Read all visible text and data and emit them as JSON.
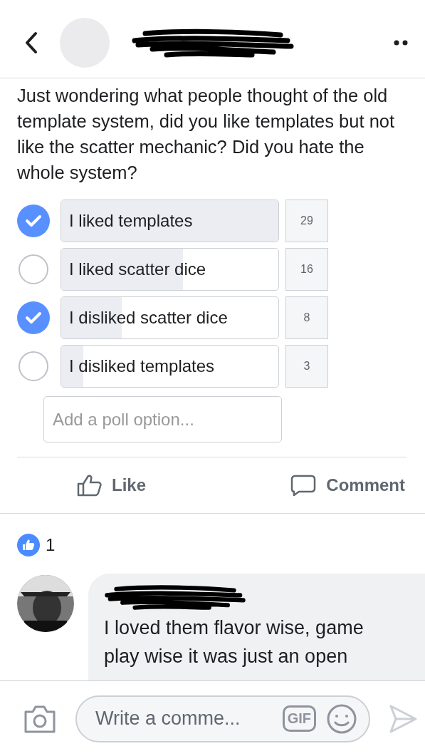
{
  "post": {
    "text": "Just wondering what people thought of the old template system, did you like templates but not like the scatter mechanic? Did you hate the whole system?"
  },
  "poll": {
    "options": [
      {
        "label": "I liked templates",
        "count": "29",
        "checked": true,
        "level": 1
      },
      {
        "label": "I liked scatter dice",
        "count": "16",
        "checked": false,
        "level": 0.56
      },
      {
        "label": "I disliked scatter dice",
        "count": "8",
        "checked": true,
        "level": 0.28
      },
      {
        "label": "I disliked templates",
        "count": "3",
        "checked": false,
        "level": 0.1
      }
    ],
    "add_placeholder": "Add a poll option..."
  },
  "actions": [
    {
      "kind": "like",
      "label": "Like"
    },
    {
      "kind": "comment",
      "label": "Comment"
    }
  ],
  "reactions": {
    "count": "1"
  },
  "comments": [
    {
      "lines": [
        "I loved them flavor wise, game",
        "play wise it was just an open"
      ]
    }
  ],
  "composer": {
    "placeholder": "Write a comme...",
    "gif": "GIF"
  }
}
